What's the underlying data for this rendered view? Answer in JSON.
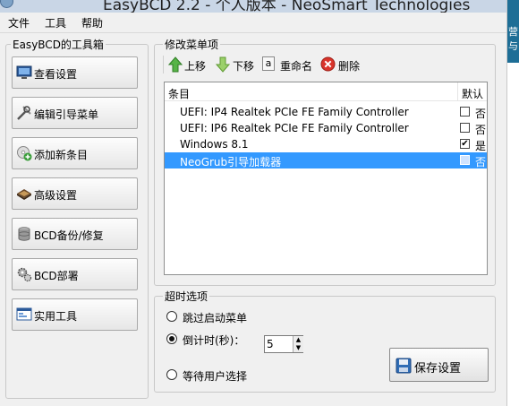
{
  "window": {
    "title": "EasyBCD 2.2 - 个人版本 - NeoSmart Technologies"
  },
  "menu": [
    "文件",
    "工具",
    "帮助"
  ],
  "sidebar": {
    "title": "EasyBCD的工具箱",
    "buttons": [
      "查看设置",
      "编辑引导菜单",
      "添加新条目",
      "高级设置",
      "BCD备份/修复",
      "BCD部署",
      "实用工具"
    ]
  },
  "edit_menu": {
    "title": "修改菜单项",
    "toolbar": {
      "up": "上移",
      "down": "下移",
      "rename": "重命名",
      "delete": "删除",
      "rename_glyph": "a"
    },
    "columns": {
      "entry": "条目",
      "default": "默认"
    },
    "rows": [
      {
        "name": "UEFI: IP4 Realtek PCIe FE Family Controller",
        "checked": "",
        "default": "否"
      },
      {
        "name": "UEFI: IP6 Realtek PCIe FE Family Controller",
        "checked": "",
        "default": "否"
      },
      {
        "name": "Windows 8.1",
        "checked": "✔",
        "default": "是"
      },
      {
        "name": "NeoGrub引导加载器",
        "checked": "",
        "default": "否"
      }
    ]
  },
  "timeout": {
    "title": "超时选项",
    "skip": "跳过启动菜单",
    "countdown": "倒计时(秒)：",
    "countdown_value": "5",
    "wait": "等待用户选择"
  },
  "save_button": "保存设置",
  "right_edge": {
    "chars": [
      "营",
      "与"
    ]
  }
}
